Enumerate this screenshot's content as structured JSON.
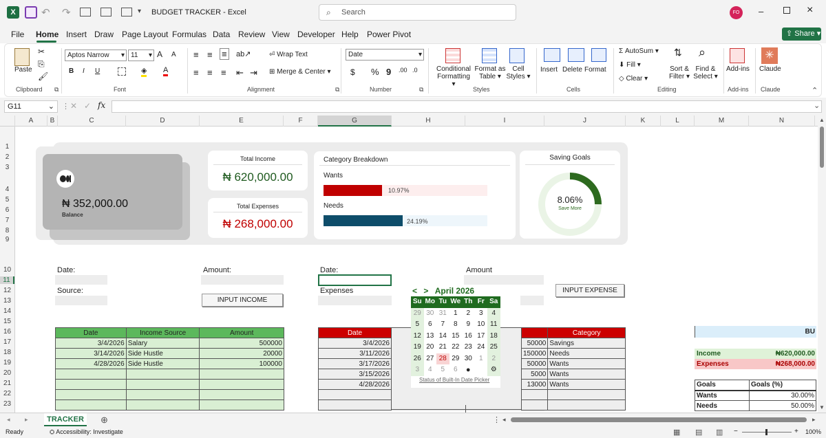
{
  "app": {
    "title": "BUDGET TRACKER",
    "app_name": "Excel",
    "separator": "-",
    "search_placeholder": "Search",
    "user_initials": "FO",
    "share_label": "Share",
    "icon_letter": "X"
  },
  "menu": [
    "File",
    "Home",
    "Insert",
    "Draw",
    "Page Layout",
    "Formulas",
    "Data",
    "Review",
    "View",
    "Developer",
    "Help",
    "Power Pivot"
  ],
  "ribbon": {
    "clipboard": {
      "label": "Clipboard",
      "paste": "Paste"
    },
    "font": {
      "label": "Font",
      "name": "Aptos Narrow",
      "size": "11",
      "bold": "B",
      "italic": "I",
      "underline": "U",
      "grow": "A",
      "shrink": "A",
      "color_a": "A"
    },
    "alignment": {
      "label": "Alignment",
      "wrap": "Wrap Text",
      "merge": "Merge & Center"
    },
    "number": {
      "label": "Number",
      "format": "Date",
      "currency": "$",
      "percent": "%",
      "comma": "9"
    },
    "styles": {
      "label": "Styles",
      "cond1": "Conditional",
      "cond2": "Formatting",
      "fmt1": "Format as",
      "fmt2": "Table",
      "cell1": "Cell",
      "cell2": "Styles"
    },
    "cells": {
      "label": "Cells",
      "insert": "Insert",
      "delete": "Delete",
      "format": "Format"
    },
    "editing": {
      "label": "Editing",
      "autosum": "AutoSum",
      "fill": "Fill",
      "clear": "Clear",
      "sort1": "Sort &",
      "sort2": "Filter",
      "find1": "Find &",
      "find2": "Select"
    },
    "addins": {
      "label": "Add-ins",
      "btn": "Add-ins"
    },
    "claude": {
      "label": "Claude",
      "btn": "Claude"
    }
  },
  "formula_bar": {
    "name_box": "G11",
    "fx": "fx",
    "value": ""
  },
  "columns": [
    "A",
    "B",
    "C",
    "D",
    "E",
    "F",
    "G",
    "H",
    "I",
    "J",
    "K",
    "L",
    "M",
    "N"
  ],
  "rows": [
    "1",
    "2",
    "3",
    "4",
    "5",
    "6",
    "7",
    "8",
    "9",
    "10",
    "11",
    "12",
    "13",
    "14",
    "15",
    "16",
    "17",
    "18",
    "19",
    "20",
    "21",
    "22",
    "23"
  ],
  "dashboard": {
    "balance": {
      "amount": "₦ 352,000.00",
      "label": "Balance"
    },
    "income": {
      "label": "Total Income",
      "amount": "₦ 620,000.00"
    },
    "expenses": {
      "label": "Total Expenses",
      "amount": "₦ 268,000.00"
    },
    "breakdown": {
      "title": "Category Breakdown",
      "wants_label": "Wants",
      "wants_pct": "10.97%",
      "wants_fill": 0.1097,
      "needs_label": "Needs",
      "needs_pct": "24.19%",
      "needs_fill": 0.2419
    },
    "saving": {
      "title": "Saving Goals",
      "pct": "8.06%",
      "fill": 0.0806,
      "sub": "Save More"
    }
  },
  "form": {
    "date1": "Date:",
    "source": "Source:",
    "amount": "Amount:",
    "income_btn": "INPUT INCOME",
    "date2": "Date:",
    "expenses": "Expenses",
    "amount2": "Amount",
    "expense_btn": "INPUT EXPENSE"
  },
  "income_table": {
    "headers": [
      "Date",
      "Income Source",
      "Amount"
    ],
    "rows": [
      [
        "3/4/2026",
        "Salary",
        "500000"
      ],
      [
        "3/14/2026",
        "Side Hustle",
        "20000"
      ],
      [
        "4/28/2026",
        "Side Hustle",
        "100000"
      ]
    ]
  },
  "expense_table": {
    "header_date": "Date",
    "dates": [
      "3/4/2026",
      "3/11/2026",
      "3/17/2026",
      "3/15/2026",
      "4/28/2026"
    ],
    "header_category": "Category",
    "amounts": [
      "50000",
      "150000",
      "50000",
      "5000",
      "13000"
    ],
    "categories": [
      "Savings",
      "Needs",
      "Wants",
      "Wants",
      "Wants"
    ]
  },
  "summary": {
    "header": "BU",
    "income_label": "Income",
    "income_value": "₦620,000.00",
    "expenses_label": "Expenses",
    "expenses_value": "₦268,000.00",
    "goals_header": "Goals",
    "goals_pct_header": "Goals (%)",
    "wants": "Wants",
    "wants_pct": "30.00%",
    "needs": "Needs",
    "needs_pct": "50.00%"
  },
  "calendar": {
    "prev": "<",
    "next": ">",
    "month": "April 2026",
    "days": [
      "Su",
      "Mo",
      "Tu",
      "We",
      "Th",
      "Fr",
      "Sa"
    ],
    "weeks": [
      [
        "29",
        "30",
        "31",
        "1",
        "2",
        "3",
        "4"
      ],
      [
        "5",
        "6",
        "7",
        "8",
        "9",
        "10",
        "11"
      ],
      [
        "12",
        "13",
        "14",
        "15",
        "16",
        "17",
        "18"
      ],
      [
        "19",
        "20",
        "21",
        "22",
        "23",
        "24",
        "25"
      ],
      [
        "26",
        "27",
        "28",
        "29",
        "30",
        "1",
        "2"
      ],
      [
        "3",
        "4",
        "5",
        "6",
        "",
        "",
        " "
      ]
    ],
    "status_link": "Status of Built-In Date Picker"
  },
  "sheet_tab": "TRACKER",
  "status": {
    "ready": "Ready",
    "accessibility": "Accessibility: Investigate",
    "zoom": "100%"
  },
  "colors": {
    "excel_green": "#217346",
    "green_header": "#5cb85c",
    "red_header": "#cc0000",
    "wants_bar": "#c00000",
    "needs_bar": "#0e4d6a",
    "ring": "#2d6a1f"
  }
}
